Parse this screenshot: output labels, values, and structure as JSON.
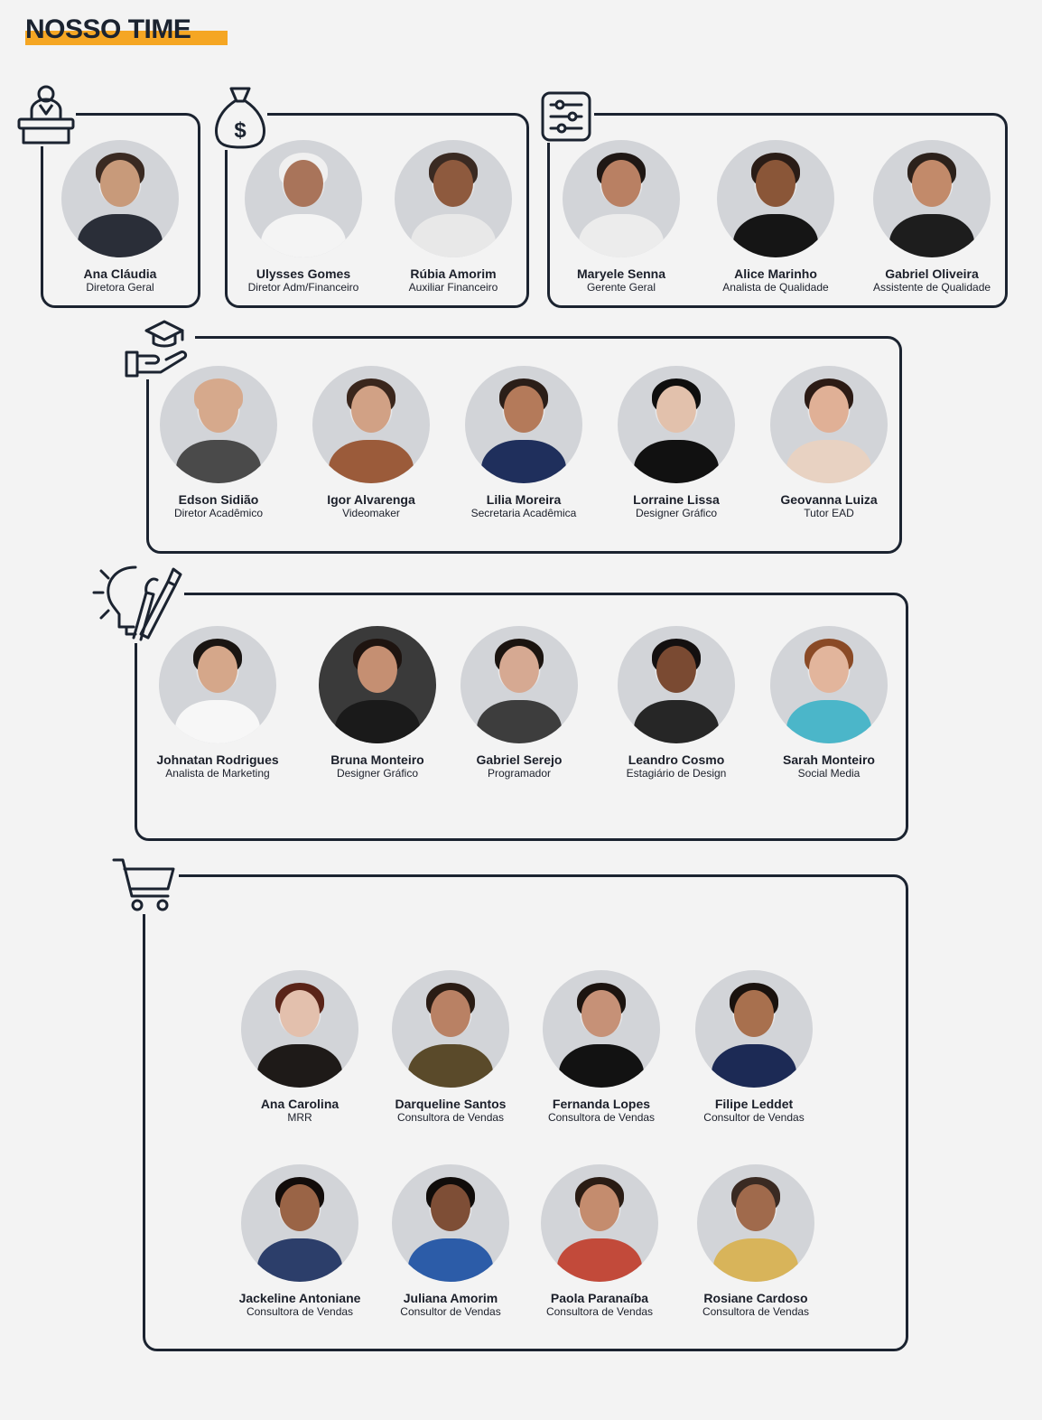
{
  "title": "NOSSO TIME",
  "colors": {
    "accent": "#f5a623",
    "line": "#1b2330"
  },
  "groups": [
    {
      "icon": "podium-speaker-icon",
      "members": [
        {
          "name": "Ana Cláudia",
          "role": "Diretora Geral"
        }
      ]
    },
    {
      "icon": "money-bag-icon",
      "members": [
        {
          "name": "Ulysses Gomes",
          "role": "Diretor Adm/Financeiro"
        },
        {
          "name": "Rúbia Amorim",
          "role": "Auxiliar Financeiro"
        }
      ]
    },
    {
      "icon": "sliders-icon",
      "members": [
        {
          "name": "Maryele Senna",
          "role": "Gerente Geral"
        },
        {
          "name": "Alice Marinho",
          "role": "Analista de Qualidade"
        },
        {
          "name": "Gabriel Oliveira",
          "role": "Assistente de Qualidade"
        }
      ]
    },
    {
      "icon": "graduation-cap-hand-icon",
      "members": [
        {
          "name": "Edson Sidião",
          "role": "Diretor Acadêmico"
        },
        {
          "name": "Igor Alvarenga",
          "role": "Videomaker"
        },
        {
          "name": "Lilia Moreira",
          "role": "Secretaria Acadêmica"
        },
        {
          "name": "Lorraine Lissa",
          "role": "Designer Gráfico"
        },
        {
          "name": "Geovanna Luiza",
          "role": "Tutor EAD"
        }
      ]
    },
    {
      "icon": "lightbulb-brush-icon",
      "members": [
        {
          "name": "Johnatan Rodrigues",
          "role": "Analista de Marketing"
        },
        {
          "name": "Bruna Monteiro",
          "role": "Designer Gráfico"
        },
        {
          "name": "Gabriel Serejo",
          "role": "Programador"
        },
        {
          "name": "Leandro Cosmo",
          "role": "Estagiário de Design"
        },
        {
          "name": "Sarah Monteiro",
          "role": "Social Media"
        }
      ]
    },
    {
      "icon": "shopping-cart-icon",
      "members": [
        {
          "name": "Ana Carolina",
          "role": "MRR"
        },
        {
          "name": "Darqueline Santos",
          "role": "Consultora de Vendas"
        },
        {
          "name": "Fernanda Lopes",
          "role": "Consultora de Vendas"
        },
        {
          "name": "Filipe Leddet",
          "role": "Consultor de Vendas"
        },
        {
          "name": "Jackeline Antoniane",
          "role": "Consultora de Vendas"
        },
        {
          "name": "Juliana Amorim",
          "role": "Consultor de Vendas"
        },
        {
          "name": "Paola Paranaíba",
          "role": "Consultora de Vendas"
        },
        {
          "name": "Rosiane Cardoso",
          "role": "Consultora de Vendas"
        }
      ]
    }
  ]
}
